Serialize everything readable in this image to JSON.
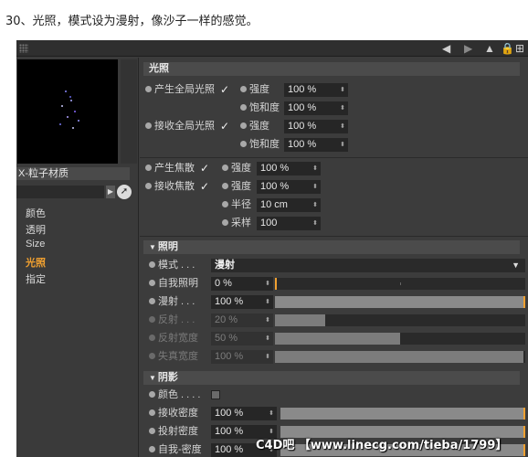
{
  "caption": "30、光照，模式设为漫射，像沙子一样的感觉。",
  "material_name": "X-粒子材质",
  "channels": [
    "颜色",
    "透明",
    "Size",
    "光照",
    "指定"
  ],
  "active_channel": "光照",
  "sections": {
    "gi_title": "光照",
    "lighting_title": "照明",
    "shadow_title": "阴影"
  },
  "gi": {
    "generate_label": "产生全局光照",
    "generate_checked": true,
    "receive_label": "接收全局光照",
    "receive_checked": true,
    "strength_label": "强度",
    "saturation_label": "饱和度",
    "gen_strength": "100 %",
    "gen_saturation": "100 %",
    "recv_strength": "100 %",
    "recv_saturation": "100 %"
  },
  "caustics": {
    "generate_label": "产生焦散",
    "receive_label": "接收焦散",
    "generate_checked": true,
    "receive_checked": true,
    "strength_label": "强度",
    "radius_label": "半径",
    "samples_label": "采样",
    "gen_strength": "100 %",
    "recv_strength": "100 %",
    "radius": "10 cm",
    "samples": "100"
  },
  "lighting": {
    "mode_label": "模式 . . .",
    "mode_value": "漫射",
    "params": [
      {
        "label": "自我照明",
        "value": "0 %",
        "fraction": 0.0,
        "dim": false
      },
      {
        "label": "漫射 . . .",
        "value": "100 %",
        "fraction": 1.0,
        "dim": false
      },
      {
        "label": "反射 . . .",
        "value": "20 %",
        "fraction": 0.2,
        "dim": true
      },
      {
        "label": "反射宽度",
        "value": "50 %",
        "fraction": 0.5,
        "dim": true
      },
      {
        "label": "失真宽度",
        "value": "100 %",
        "fraction": 1.0,
        "dim": true
      }
    ]
  },
  "shadow": {
    "color_label": "颜色 . . . .",
    "params": [
      {
        "label": "接收密度",
        "value": "100 %",
        "fraction": 1.0
      },
      {
        "label": "投射密度",
        "value": "100 %",
        "fraction": 1.0
      },
      {
        "label": "自我-密度",
        "value": "100 %",
        "fraction": 1.0
      }
    ]
  },
  "check_glyph": "✓",
  "watermark": "C4D吧 【www.linecg.com/tieba/1799】",
  "icons": [
    "grip-icon",
    "arrow-left-icon",
    "lock-icon",
    "expand-icon",
    "picker-icon"
  ],
  "accent_color": "#f0a030"
}
